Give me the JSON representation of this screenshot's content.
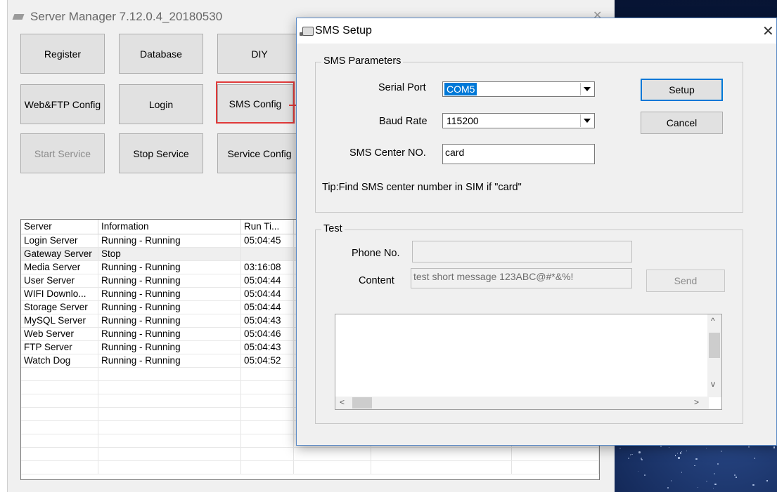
{
  "main": {
    "title": "Server Manager 7.12.0.4_20180530",
    "buttons": {
      "register": "Register",
      "database": "Database",
      "diy": "DIY",
      "webftp": "Web&FTP Config",
      "login": "Login",
      "sms_config": "SMS Config",
      "start_service": "Start Service",
      "stop_service": "Stop Service",
      "service_config": "Service Config"
    },
    "table": {
      "columns": [
        "Server",
        "Information",
        "Run Ti..."
      ],
      "rows": [
        [
          "Login Server",
          "Running - Running",
          "05:04:45"
        ],
        [
          "Gateway Server",
          "Stop",
          ""
        ],
        [
          "Media Server",
          "Running - Running",
          "03:16:08"
        ],
        [
          "User Server",
          "Running - Running",
          "05:04:44"
        ],
        [
          "WIFI Downlo...",
          "Running - Running",
          "05:04:44"
        ],
        [
          "Storage Server",
          "Running - Running",
          "05:04:44"
        ],
        [
          "MySQL Server",
          "Running - Running",
          "05:04:43"
        ],
        [
          "Web Server",
          "Running - Running",
          "05:04:46"
        ],
        [
          "FTP Server",
          "Running - Running",
          "05:04:43"
        ],
        [
          "Watch Dog",
          "Running - Running",
          "05:04:52"
        ]
      ]
    }
  },
  "dialog": {
    "title": "SMS Setup",
    "sms_parameters": {
      "group_label": "SMS Parameters",
      "serial_port_label": "Serial Port",
      "serial_port_value": "COM5",
      "baud_rate_label": "Baud Rate",
      "baud_rate_value": "115200",
      "center_label": "SMS Center NO.",
      "center_value": "card",
      "tip": "Tip:Find SMS center number in SIM if \"card\""
    },
    "setup_label": "Setup",
    "cancel_label": "Cancel",
    "test": {
      "group_label": "Test",
      "phone_label": "Phone No.",
      "phone_value": "",
      "content_label": "Content",
      "content_value": "test short message 123ABC@#*&%!",
      "send_label": "Send"
    }
  },
  "colors": {
    "highlight": "#e03a3a",
    "selection": "#0078d7",
    "dialog_border": "#5a8ac6"
  }
}
